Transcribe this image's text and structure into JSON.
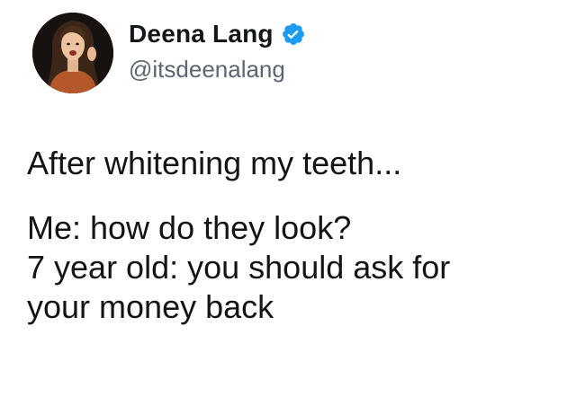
{
  "author": {
    "display_name": "Deena Lang",
    "handle": "@itsdeenalang",
    "verified": true,
    "verified_badge_icon": "verified-checkmark-icon",
    "verified_color": "#1d9bf0"
  },
  "tweet": {
    "lines": [
      "After whitening my teeth...",
      "Me: how do they look?",
      "7 year old: you should ask for",
      "your money back"
    ]
  }
}
